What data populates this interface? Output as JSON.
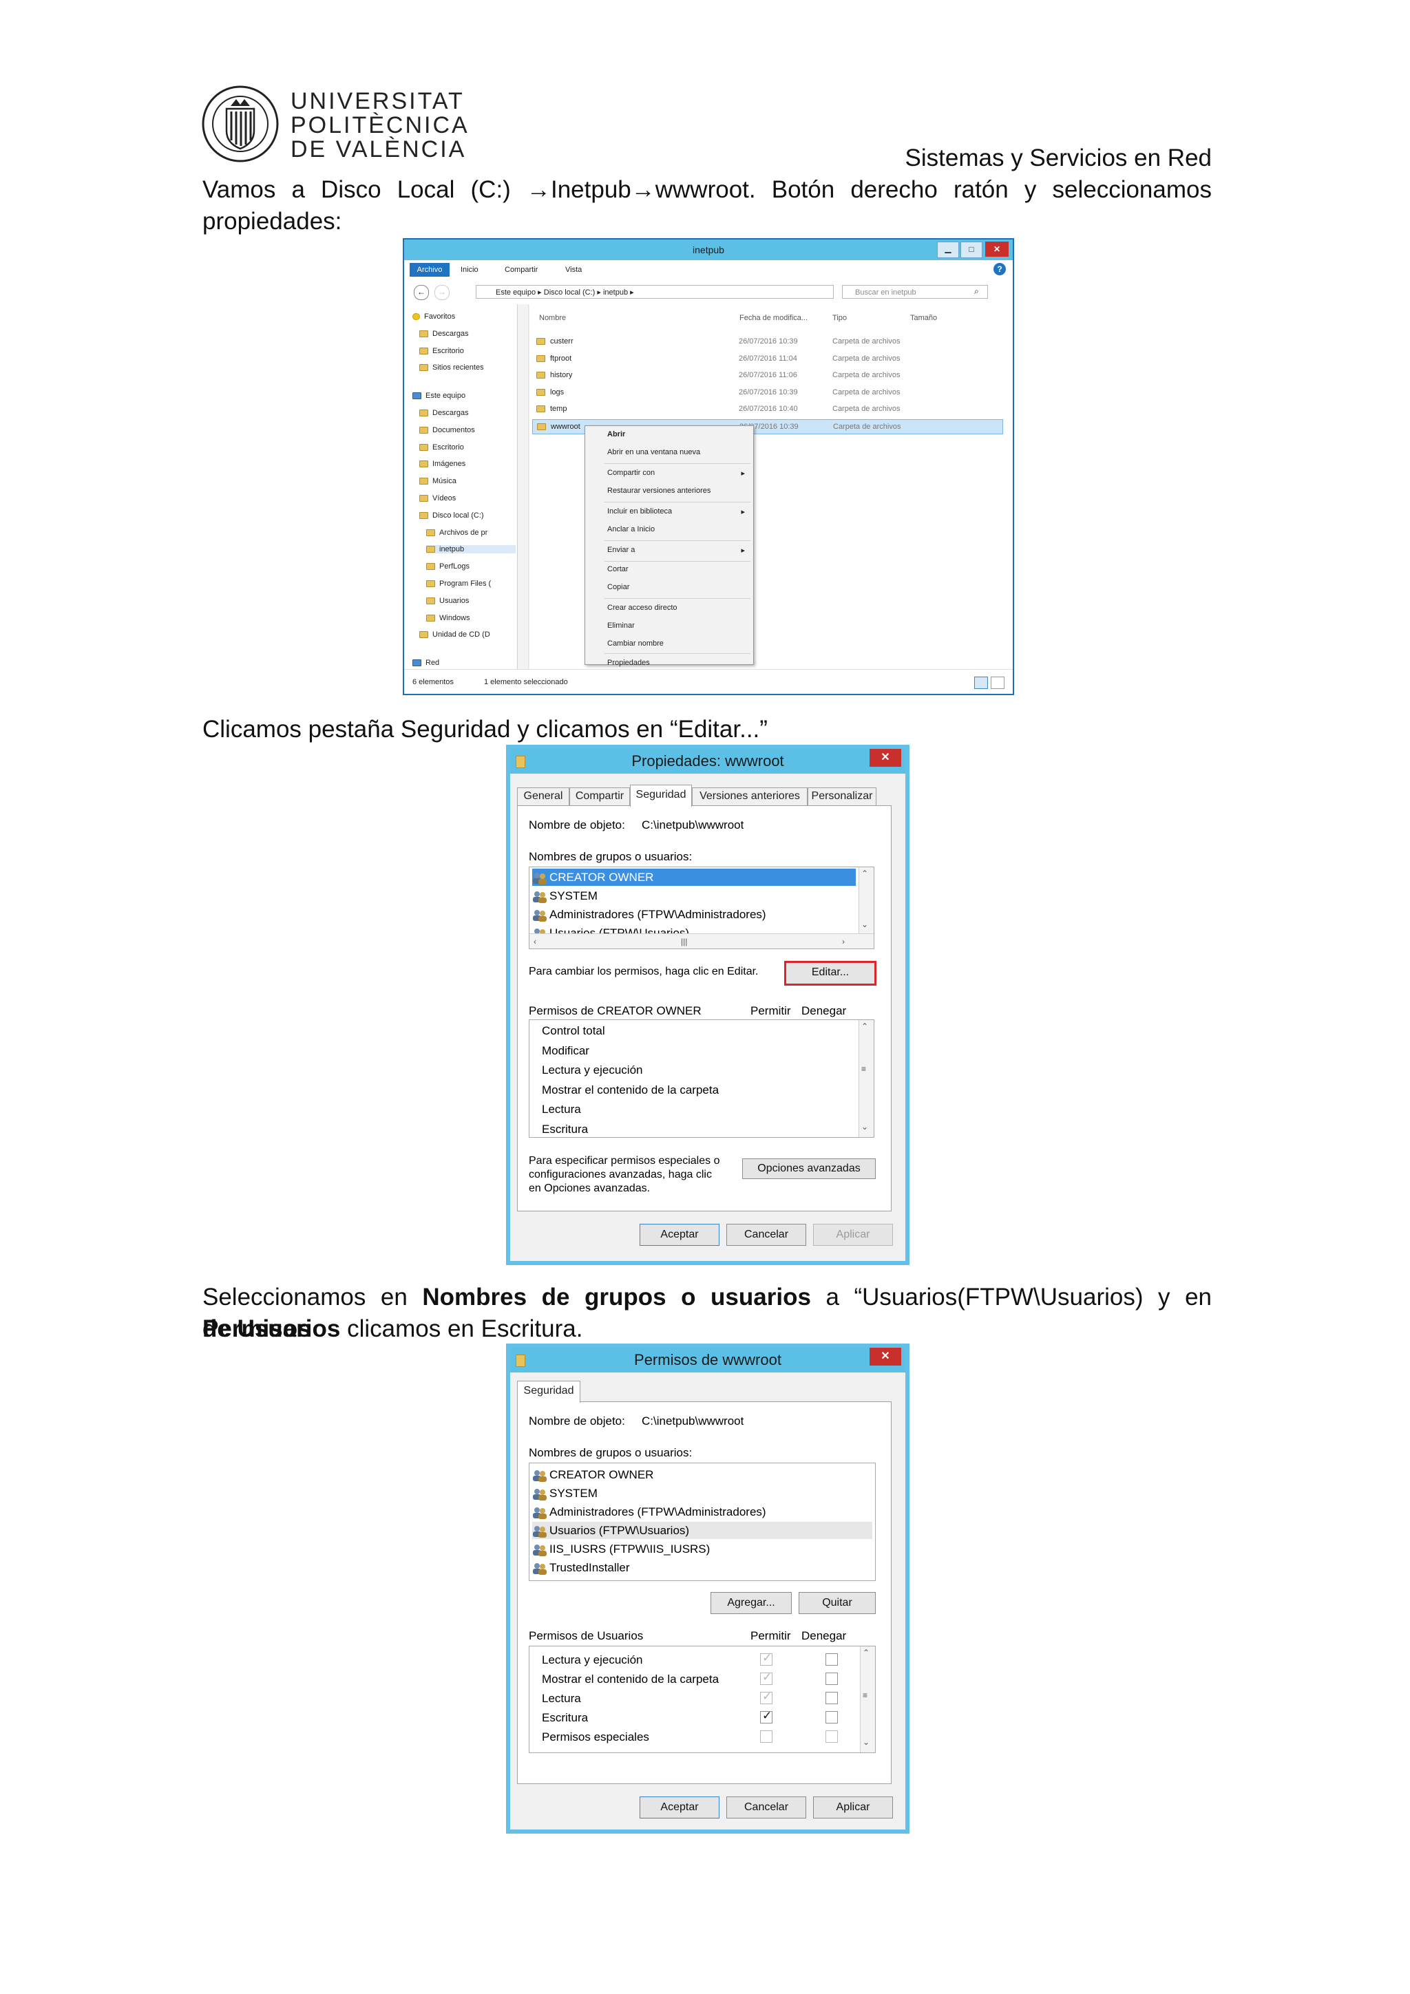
{
  "header": {
    "logo_lines": [
      "UNIVERSITAT",
      "POLITÈCNICA",
      "DE VALÈNCIA"
    ],
    "seal_text": "UNIVERSITAT POLITECNICA VALENCIA",
    "course": "Sistemas y Servicios en Red"
  },
  "paragraphs": {
    "p1_line1_a": "Vamos a Disco Local (C:)",
    "arrow": "→",
    "p1_line1_b": "Inetpub",
    "p1_line1_c": "wwwroot. Botón derecho ratón y seleccionamos",
    "p1_line2": "propiedades:",
    "p2": "Clicamos pestaña Seguridad y clicamos en “Editar...”",
    "p3_a": "Seleccionamos en",
    "p3_b": "Nombres de grupos o usuarios",
    "p3_c": "a “Usuarios(FTPW\\Usuarios) y en",
    "p3_d": "Permisos",
    "p3_e": "de Usuarios",
    "p3_f": "clicamos en Escritura."
  },
  "explorer": {
    "title": "inetpub",
    "ribbon_tabs": [
      "Archivo",
      "Inicio",
      "Compartir",
      "Vista"
    ],
    "address": [
      "Este equipo",
      "Disco local (C:)",
      "inetpub"
    ],
    "search_placeholder": "Buscar en inetpub",
    "columns": [
      "Nombre",
      "Fecha de modifica...",
      "Tipo",
      "Tamaño"
    ],
    "rows": [
      {
        "name": "custerr",
        "date": "26/07/2016 10:39",
        "type": "Carpeta de archivos"
      },
      {
        "name": "ftproot",
        "date": "26/07/2016 11:04",
        "type": "Carpeta de archivos"
      },
      {
        "name": "history",
        "date": "26/07/2016 11:06",
        "type": "Carpeta de archivos"
      },
      {
        "name": "logs",
        "date": "26/07/2016 10:39",
        "type": "Carpeta de archivos"
      },
      {
        "name": "temp",
        "date": "26/07/2016 10:40",
        "type": "Carpeta de archivos"
      },
      {
        "name": "wwwroot",
        "date": "26/07/2016 10:39",
        "type": "Carpeta de archivos"
      }
    ],
    "nav": [
      "Favoritos",
      "Descargas",
      "Escritorio",
      "Sitios recientes",
      "Este equipo",
      "Descargas",
      "Documentos",
      "Escritorio",
      "Imágenes",
      "Música",
      "Vídeos",
      "Disco local (C:)",
      "Archivos de pr",
      "inetpub",
      "PerfLogs",
      "Program Files (",
      "Usuarios",
      "Windows",
      "Unidad de CD (D",
      "Red"
    ],
    "context_menu": [
      "Abrir",
      "Abrir en una ventana nueva",
      "Compartir con",
      "Restaurar versiones anteriores",
      "Incluir en biblioteca",
      "Anclar a Inicio",
      "Enviar a",
      "Cortar",
      "Copiar",
      "Crear acceso directo",
      "Eliminar",
      "Cambiar nombre",
      "Propiedades"
    ],
    "status_items": "6 elementos",
    "status_selected": "1 elemento seleccionado"
  },
  "props": {
    "title": "Propiedades: wwwroot",
    "tabs": [
      "General",
      "Compartir",
      "Seguridad",
      "Versiones anteriores",
      "Personalizar"
    ],
    "object_label": "Nombre de objeto:",
    "object_value": "C:\\inetpub\\wwwroot",
    "groups_label": "Nombres de grupos o usuarios:",
    "groups": [
      "CREATOR OWNER",
      "SYSTEM",
      "Administradores (FTPW\\Administradores)",
      "Usuarios (FTPW\\Usuarios)"
    ],
    "change_hint": "Para cambiar los permisos, haga clic en Editar.",
    "edit_button": "Editar...",
    "perms_label": "Permisos de CREATOR OWNER",
    "allow": "Permitir",
    "deny": "Denegar",
    "perms": [
      "Control total",
      "Modificar",
      "Lectura y ejecución",
      "Mostrar el contenido de la carpeta",
      "Lectura",
      "Escritura"
    ],
    "advanced_hint": [
      "Para especificar permisos especiales o",
      "configuraciones avanzadas, haga clic",
      "en Opciones avanzadas."
    ],
    "advanced_button": "Opciones avanzadas",
    "ok": "Aceptar",
    "cancel": "Cancelar",
    "apply": "Aplicar",
    "close": "✕"
  },
  "perms_dlg": {
    "title": "Permisos de wwwroot",
    "tab": "Seguridad",
    "object_label": "Nombre de objeto:",
    "object_value": "C:\\inetpub\\wwwroot",
    "groups_label": "Nombres de grupos o usuarios:",
    "groups": [
      "CREATOR OWNER",
      "SYSTEM",
      "Administradores (FTPW\\Administradores)",
      "Usuarios (FTPW\\Usuarios)",
      "IIS_IUSRS (FTPW\\IIS_IUSRS)",
      "TrustedInstaller"
    ],
    "add_button": "Agregar...",
    "remove_button": "Quitar",
    "perms_label": "Permisos de Usuarios",
    "allow": "Permitir",
    "deny": "Denegar",
    "perms": [
      "Lectura y ejecución",
      "Mostrar el contenido de la carpeta",
      "Lectura",
      "Escritura",
      "Permisos especiales"
    ],
    "ok": "Aceptar",
    "cancel": "Cancelar",
    "apply": "Aplicar",
    "close": "✕"
  }
}
